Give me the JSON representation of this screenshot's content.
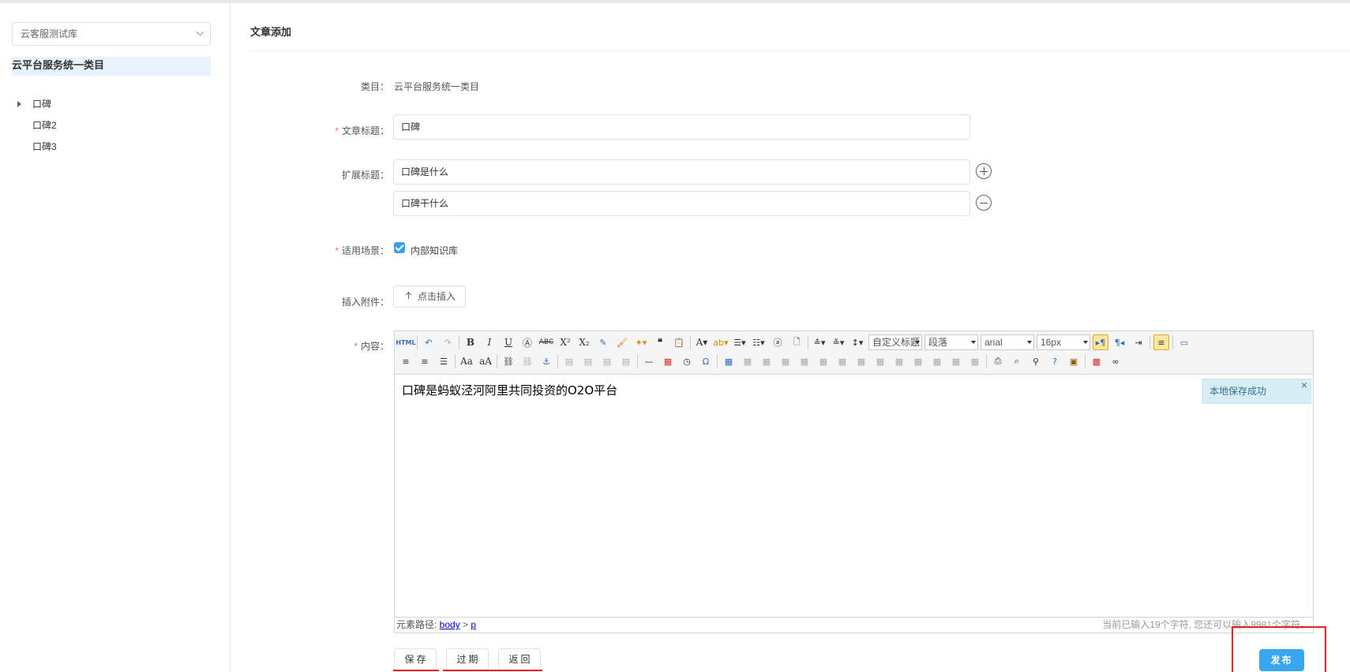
{
  "sidebar": {
    "library_select": "云客服测试库",
    "category_title": "云平台服务统一类目",
    "tree": [
      {
        "label": "口碑",
        "has_children": true
      },
      {
        "label": "口碑2",
        "has_children": false
      },
      {
        "label": "口碑3",
        "has_children": false
      }
    ]
  },
  "page": {
    "title": "文章添加"
  },
  "form": {
    "category_label": "类目：",
    "category_value": "云平台服务统一类目",
    "title_label": "文章标题：",
    "title_value": "口碑",
    "ext_title_label": "扩展标题：",
    "ext_titles": [
      "口碑是什么",
      "口碑干什么"
    ],
    "scene_label": "适用场景：",
    "scene_option": "内部知识库",
    "scene_checked": true,
    "attach_label": "插入附件：",
    "attach_button": "点击插入",
    "content_label": "内容："
  },
  "editor": {
    "toolbar_selects": {
      "heading": "自定义标题",
      "paragraph": "段落",
      "font": "arial",
      "size": "16px"
    },
    "content": "口碑是蚂蚁泾河阿里共同投资的O2O平台",
    "toast": "本地保存成功",
    "status_path_prefix": "元素路径: ",
    "status_path_body": "body",
    "status_path_sep": " > ",
    "status_path_p": "p",
    "char_count": "当前已输入19个字符, 您还可以输入9981个字符。"
  },
  "actions": {
    "save": "保存",
    "expire": "过期",
    "back": "返回",
    "publish": "发布"
  },
  "colors": {
    "accent": "#3aa6f0",
    "required": "#f56c6c",
    "highlight_red": "#e62121",
    "category_bg": "#e8f4fd"
  }
}
